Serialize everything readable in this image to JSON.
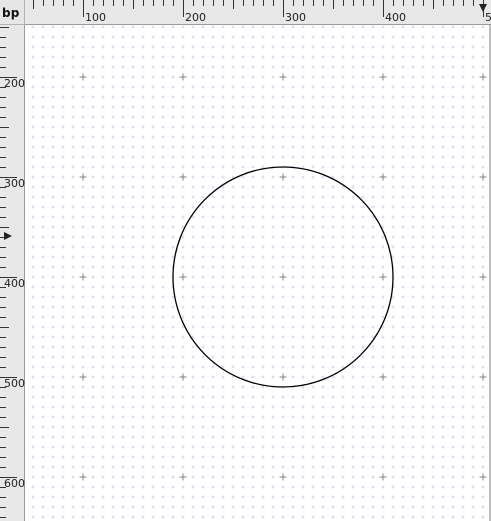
{
  "ruler": {
    "unit": "bp",
    "h_labels": [
      "100",
      "200",
      "300",
      "400",
      "5"
    ],
    "v_labels": [
      "200",
      "300",
      "400",
      "500",
      "600"
    ]
  },
  "circle": {
    "stroke": "#000000"
  },
  "colors": {
    "ruler_bg": "#e8e8e8",
    "grid_minor": "#c8c8f0",
    "grid_major": "#808080"
  }
}
